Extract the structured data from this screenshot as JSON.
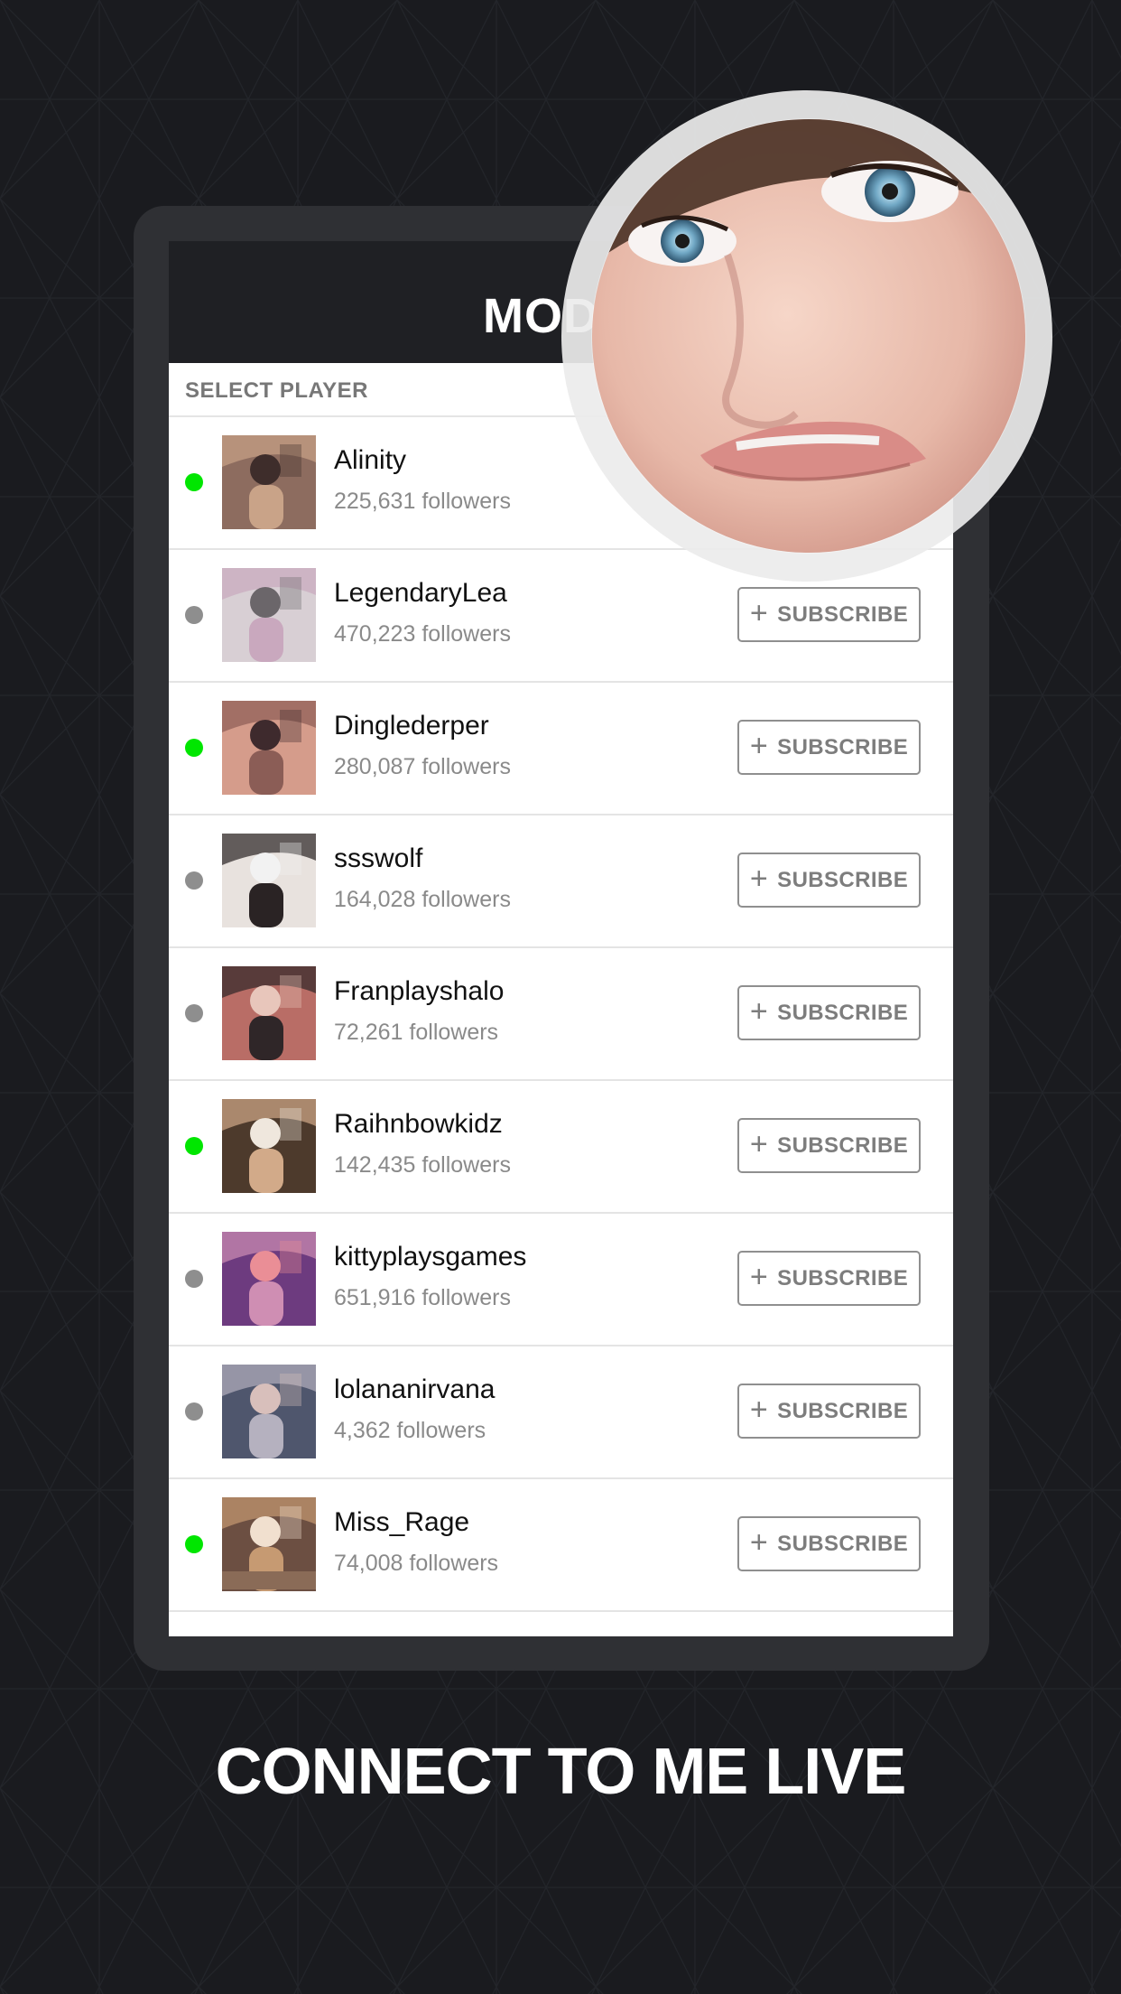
{
  "app": {
    "title": "MODELS",
    "section_label": "SELECT PLAYER",
    "tagline": "CONNECT TO ME LIVE"
  },
  "colors": {
    "background": "#1a1b1f",
    "frame": "#2f3034",
    "header": "#1f2024",
    "online": "#00e600",
    "offline": "#8e8e8e",
    "button_border": "#8f8f8f"
  },
  "players": [
    {
      "name": "Alinity",
      "followers": "225,631 followers",
      "status": "online",
      "button_label": "SUBSCRIBE",
      "icon": "plus-icon"
    },
    {
      "name": "LegendaryLea",
      "followers": "470,223 followers",
      "status": "offline",
      "button_label": "SUBSCRIBE",
      "icon": "plus-icon"
    },
    {
      "name": "Dinglederper",
      "followers": "280,087 followers",
      "status": "online",
      "button_label": "SUBSCRIBE",
      "icon": "plus-icon"
    },
    {
      "name": "ssswolf",
      "followers": "164,028 followers",
      "status": "offline",
      "button_label": "SUBSCRIBE",
      "icon": "plus-icon"
    },
    {
      "name": "Franplayshalo",
      "followers": "72,261 followers",
      "status": "offline",
      "button_label": "SUBSCRIBE",
      "icon": "plus-icon"
    },
    {
      "name": "Raihnbowkidz",
      "followers": "142,435 followers",
      "status": "online",
      "button_label": "SUBSCRIBE",
      "icon": "plus-icon"
    },
    {
      "name": "kittyplaysgames",
      "followers": "651,916 followers",
      "status": "offline",
      "button_label": "SUBSCRIBE",
      "icon": "plus-icon"
    },
    {
      "name": "lolananirvana",
      "followers": "4,362 followers",
      "status": "offline",
      "button_label": "SUBSCRIBE",
      "icon": "plus-icon"
    },
    {
      "name": "Miss_Rage",
      "followers": "74,008 followers",
      "status": "online",
      "button_label": "SUBSCRIBE",
      "icon": "plus-icon"
    }
  ]
}
